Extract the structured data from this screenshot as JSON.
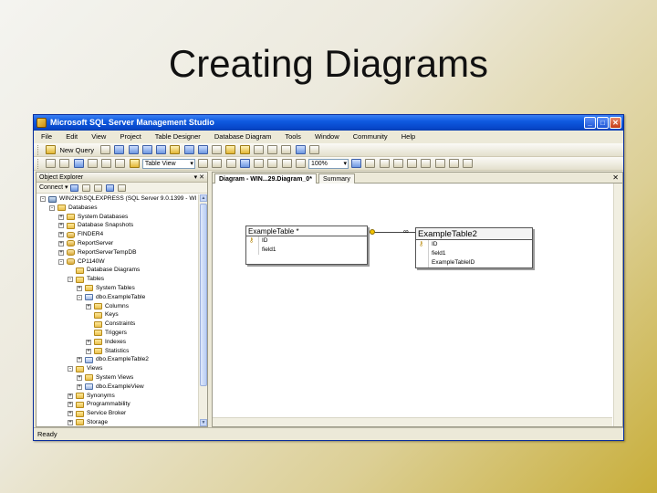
{
  "slide": {
    "title": "Creating Diagrams"
  },
  "window": {
    "title": "Microsoft SQL Server Management Studio",
    "minimize": "_",
    "maximize": "□",
    "close": "✕"
  },
  "menu": [
    "File",
    "Edit",
    "View",
    "Project",
    "Table Designer",
    "Database Diagram",
    "Tools",
    "Window",
    "Community",
    "Help"
  ],
  "toolbar": {
    "new_query": "New Query",
    "table_view": "Table View",
    "zoom": "100%"
  },
  "explorer": {
    "title": "Object Explorer",
    "connect": "Connect",
    "pin": "▾ ✕",
    "tree": [
      {
        "level": 0,
        "expander": "-",
        "icon": "srv",
        "label": "WIN2K3\\SQLEXPRESS (SQL Server 9.0.1399 - WI"
      },
      {
        "level": 1,
        "expander": "-",
        "icon": "folder",
        "label": "Databases"
      },
      {
        "level": 2,
        "expander": "+",
        "icon": "folder",
        "label": "System Databases"
      },
      {
        "level": 2,
        "expander": "+",
        "icon": "folder",
        "label": "Database Snapshots"
      },
      {
        "level": 2,
        "expander": "+",
        "icon": "db",
        "label": "FINDER4"
      },
      {
        "level": 2,
        "expander": "+",
        "icon": "db",
        "label": "ReportServer"
      },
      {
        "level": 2,
        "expander": "+",
        "icon": "db",
        "label": "ReportServerTempDB"
      },
      {
        "level": 2,
        "expander": "-",
        "icon": "db",
        "label": "CP1140W"
      },
      {
        "level": 3,
        "expander": "",
        "icon": "folder",
        "label": "Database Diagrams"
      },
      {
        "level": 3,
        "expander": "-",
        "icon": "folder",
        "label": "Tables"
      },
      {
        "level": 4,
        "expander": "+",
        "icon": "folder",
        "label": "System Tables"
      },
      {
        "level": 4,
        "expander": "-",
        "icon": "tbl",
        "label": "dbo.ExampleTable"
      },
      {
        "level": 5,
        "expander": "+",
        "icon": "folder",
        "label": "Columns"
      },
      {
        "level": 5,
        "expander": "",
        "icon": "folder",
        "label": "Keys"
      },
      {
        "level": 5,
        "expander": "",
        "icon": "folder",
        "label": "Constraints"
      },
      {
        "level": 5,
        "expander": "",
        "icon": "folder",
        "label": "Triggers"
      },
      {
        "level": 5,
        "expander": "+",
        "icon": "folder",
        "label": "Indexes"
      },
      {
        "level": 5,
        "expander": "+",
        "icon": "folder",
        "label": "Statistics"
      },
      {
        "level": 4,
        "expander": "+",
        "icon": "tbl",
        "label": "dbo.ExampleTable2"
      },
      {
        "level": 3,
        "expander": "-",
        "icon": "folder",
        "label": "Views"
      },
      {
        "level": 4,
        "expander": "+",
        "icon": "folder",
        "label": "System Views"
      },
      {
        "level": 4,
        "expander": "+",
        "icon": "tbl",
        "label": "dbo.ExampleView"
      },
      {
        "level": 3,
        "expander": "+",
        "icon": "folder",
        "label": "Synonyms"
      },
      {
        "level": 3,
        "expander": "+",
        "icon": "folder",
        "label": "Programmability"
      },
      {
        "level": 3,
        "expander": "+",
        "icon": "folder",
        "label": "Service Broker"
      },
      {
        "level": 3,
        "expander": "+",
        "icon": "folder",
        "label": "Storage"
      }
    ]
  },
  "tabs": [
    {
      "label": "Diagram - WIN...29.Diagram_0*",
      "active": true
    },
    {
      "label": "Summary",
      "active": false
    }
  ],
  "tab_close": "✕",
  "diagram": {
    "table1": {
      "title": "ExampleTable *",
      "columns": [
        {
          "key": true,
          "name": "ID"
        },
        {
          "key": false,
          "name": "field1"
        }
      ]
    },
    "table2": {
      "title": "ExampleTable2",
      "columns": [
        {
          "key": true,
          "name": "ID"
        },
        {
          "key": false,
          "name": "field1"
        },
        {
          "key": false,
          "name": "ExampleTableID"
        }
      ]
    }
  },
  "status": {
    "text": "Ready"
  },
  "colors": {
    "titlebar": "#0a46c9",
    "window_bg": "#ece9d8",
    "accent_gold": "#c8ae3a"
  }
}
